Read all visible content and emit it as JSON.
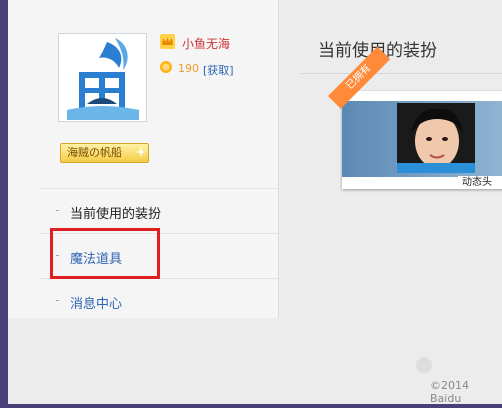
{
  "user": {
    "name": "小鱼无海",
    "coins": "190",
    "get_label": "[获取]",
    "badge": "海贼の帆船"
  },
  "nav": {
    "items": [
      {
        "label": "当前使用的装扮"
      },
      {
        "label": "魔法道具"
      },
      {
        "label": "消息中心"
      }
    ]
  },
  "main": {
    "title": "当前使用的装扮",
    "card": {
      "ribbon": "已拥有",
      "caption": "动态头"
    }
  },
  "footer": {
    "copyright": "©2014 Baidu"
  },
  "colors": {
    "accent_red": "#e02020",
    "link_blue": "#2d64b3",
    "ribbon_orange": "#ff8a3a"
  }
}
